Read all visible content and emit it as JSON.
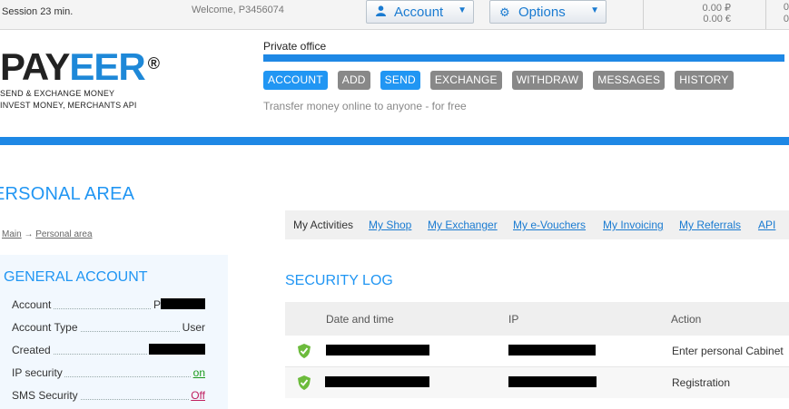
{
  "topbar": {
    "session": "Session 23 min.",
    "welcome": "Welcome, P3456074",
    "account_dropdown": "Account",
    "options_dropdown": "Options",
    "balance_rub": "0.00 ₽",
    "balance_eur": "0.00 €",
    "balance_col2_top": "0",
    "balance_col2_bottom": "0"
  },
  "logo": {
    "part1": "PAY",
    "part2": "EER",
    "registered": "®",
    "tagline1": "SEND & EXCHANGE MONEY",
    "tagline2": "INVEST MONEY, MERCHANTS API"
  },
  "private_office": {
    "title": "Private office",
    "nav": [
      "ACCOUNT",
      "ADD",
      "SEND",
      "EXCHANGE",
      "WITHDRAW",
      "MESSAGES",
      "HISTORY"
    ],
    "active_nav": [
      "ACCOUNT",
      "SEND"
    ],
    "subtitle": "Transfer money online to anyone - for free"
  },
  "personal_area": {
    "title": "ERSONAL AREA",
    "breadcrumb": {
      "main": "Main",
      "arrow": "→",
      "current": "Personal area"
    }
  },
  "general_account": {
    "title": "GENERAL ACCOUNT",
    "rows": [
      {
        "key": "Account",
        "value": "P"
      },
      {
        "key": "Account Type",
        "value": "User"
      },
      {
        "key": "Created",
        "value": ""
      },
      {
        "key": "IP security",
        "value": "on"
      },
      {
        "key": "SMS Security",
        "value": "Off"
      }
    ]
  },
  "tabs": [
    "My Activities",
    "My Shop",
    "My Exchanger",
    "My e-Vouchers",
    "My Invoicing",
    "My Referrals",
    "API"
  ],
  "security_log": {
    "title": "SECURITY LOG",
    "columns": [
      "Date and time",
      "IP",
      "Action"
    ],
    "rows": [
      {
        "action": "Enter personal Cabinet"
      },
      {
        "action": "Registration"
      }
    ]
  },
  "colors": {
    "accent": "#1e88e5",
    "link": "#1a7bd1",
    "nav_gray": "#888888",
    "on": "#1a9a1a",
    "off": "#c02060"
  },
  "icons": [
    "user-icon",
    "gear-icon",
    "caret-down-icon",
    "shield-check-icon"
  ]
}
